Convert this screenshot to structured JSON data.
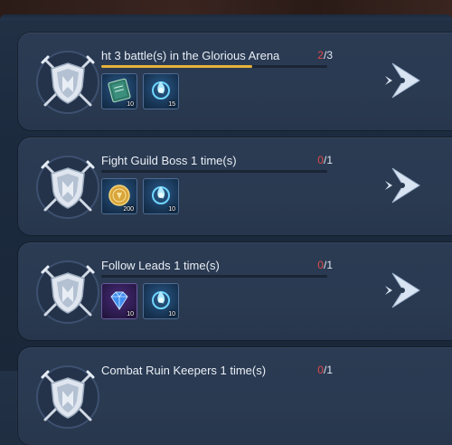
{
  "quests": [
    {
      "title": "ht 3 battle(s) in the Glorious Arena",
      "current": "2",
      "total": "/3",
      "progress": 0.6667,
      "rewards": [
        {
          "icon": "book-item-icon",
          "count": "10",
          "tint": "blue"
        },
        {
          "icon": "soul-flame-icon",
          "count": "15",
          "tint": "blue"
        }
      ]
    },
    {
      "title": "Fight Guild Boss 1 time(s)",
      "current": "0",
      "total": "/1",
      "progress": 0,
      "rewards": [
        {
          "icon": "gold-coin-icon",
          "count": "200",
          "tint": "blue"
        },
        {
          "icon": "soul-flame-icon",
          "count": "10",
          "tint": "blue"
        }
      ]
    },
    {
      "title": "Follow Leads 1 time(s)",
      "current": "0",
      "total": "/1",
      "progress": 0,
      "rewards": [
        {
          "icon": "diamond-gem-icon",
          "count": "10",
          "tint": "purple"
        },
        {
          "icon": "soul-flame-icon",
          "count": "10",
          "tint": "blue"
        }
      ]
    },
    {
      "title": "Combat Ruin Keepers 1 time(s)",
      "current": "0",
      "total": "/1",
      "progress": 0,
      "rewards": []
    }
  ],
  "colors": {
    "accent_progress": "#e7b23a",
    "current_count": "#e04a4a",
    "panel": "#2a3a51"
  }
}
